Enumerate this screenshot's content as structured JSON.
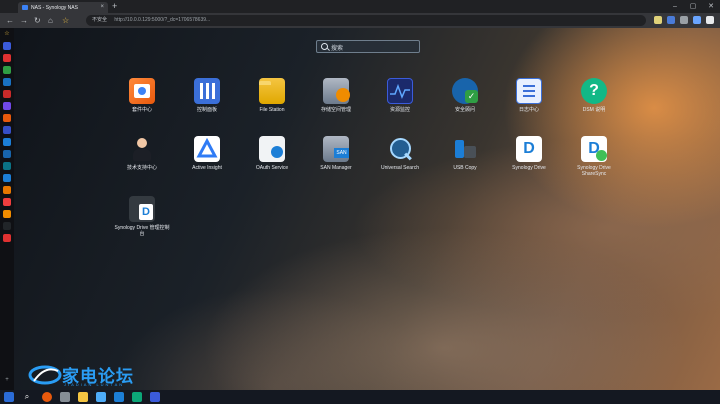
{
  "browser": {
    "tab_title": "NAS - Synology NAS",
    "address_label": "不安全",
    "url": "http://10.0.0.129:5000/?_dc=1706578639..."
  },
  "desktop": {
    "search_placeholder": "搜索",
    "apps": [
      {
        "label": "套件中心",
        "icon": "package-center-icon"
      },
      {
        "label": "控制面板",
        "icon": "control-panel-icon"
      },
      {
        "label": "File Station",
        "icon": "file-station-icon"
      },
      {
        "label": "存储空间管理",
        "icon": "storage-manager-icon"
      },
      {
        "label": "资源监控",
        "icon": "resource-monitor-icon"
      },
      {
        "label": "安全顾问",
        "icon": "security-advisor-icon"
      },
      {
        "label": "日志中心",
        "icon": "log-center-icon"
      },
      {
        "label": "DSM 说明",
        "icon": "dsm-help-icon"
      },
      {
        "label": "技术支持中心",
        "icon": "support-center-icon"
      },
      {
        "label": "Active Insight",
        "icon": "active-insight-icon"
      },
      {
        "label": "OAuth Service",
        "icon": "oauth-service-icon"
      },
      {
        "label": "SAN Manager",
        "icon": "san-manager-icon"
      },
      {
        "label": "Universal Search",
        "icon": "universal-search-icon"
      },
      {
        "label": "USB Copy",
        "icon": "usb-copy-icon"
      },
      {
        "label": "Synology Drive",
        "icon": "synology-drive-icon"
      },
      {
        "label": "Synology Drive ShareSync",
        "icon": "sharesync-icon"
      },
      {
        "label": "Synology Drive 管理控制台",
        "icon": "drive-admin-console-icon"
      }
    ]
  },
  "watermark": {
    "text": "家电论坛",
    "sub": "JIADIAN LUNTAN"
  },
  "colors": {
    "watermark": "#2a9df4",
    "search_border": "#a0b4c8"
  }
}
